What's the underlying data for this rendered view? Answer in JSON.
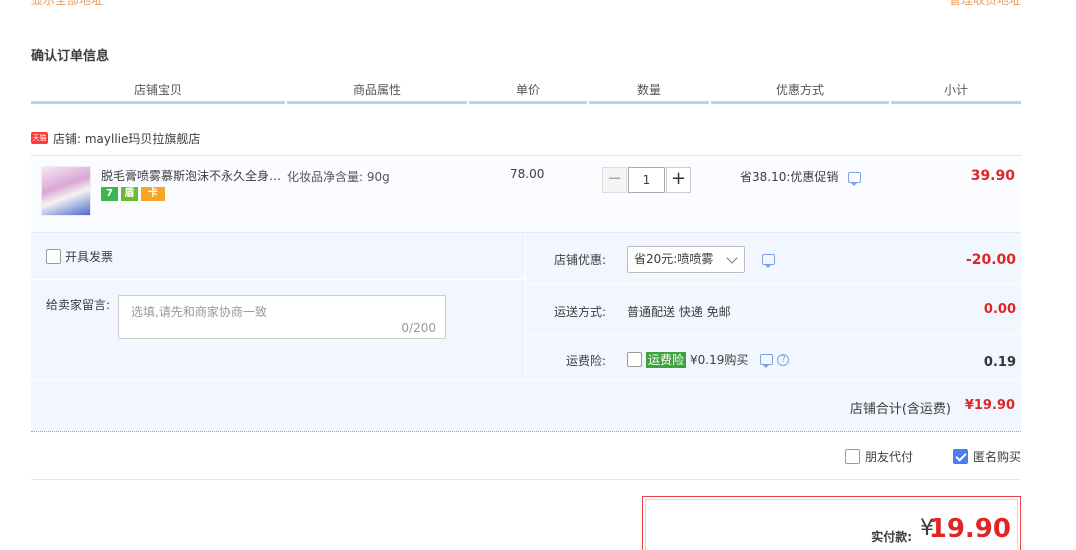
{
  "top_links": {
    "show_all": "显示全部地址",
    "manage": "管理收货地址"
  },
  "section_title": "确认订单信息",
  "columns": [
    "店铺宝贝",
    "商品属性",
    "单价",
    "数量",
    "优惠方式",
    "小计"
  ],
  "shop": {
    "badge": "天猫",
    "label": "店铺: mayllie玛贝拉旗舰店"
  },
  "item": {
    "name": "脱毛膏喷雾慕斯泡沫不永久全身…",
    "badges": [
      "7",
      "盾",
      "卡"
    ],
    "property": "化妆品净含量: 90g",
    "price": "78.00",
    "quantity": "1",
    "minus": "−",
    "plus": "+",
    "promo": "省38.10:优惠促销",
    "subtotal": "39.90"
  },
  "detail": {
    "invoice_label": "开具发票",
    "message_label": "给卖家留言:",
    "message_placeholder": "选填,请先和商家协商一致",
    "message_count": "0/200",
    "shop_discount_label": "店铺优惠:",
    "shop_discount_selected": "省20元:喷喷雾",
    "shop_discount_value": "-20.00",
    "shipping_label": "运送方式:",
    "shipping_text": "普通配送 快递 免邮",
    "shipping_value": "0.00",
    "insurance_label": "运费险:",
    "insurance_tag": "运费险",
    "insurance_text": "¥0.19购买",
    "insurance_value": "0.19",
    "total_label": "店铺合计(含运费)",
    "total_value": "¥19.90"
  },
  "options": {
    "friend_pay": "朋友代付",
    "friend_pay_checked": false,
    "anonymous": "匿名购买",
    "anonymous_checked": true
  },
  "payment": {
    "label": "实付款:",
    "yen": "¥",
    "amount": "19.90"
  },
  "colors": {
    "price_red": "#dd2727",
    "header_underline": "#b2d1ff",
    "detail_bg": "#f2f7ff",
    "checkbox_blue": "#4a7cf3",
    "insurance_green": "#3da43d",
    "link_orange": "#f09a55"
  }
}
